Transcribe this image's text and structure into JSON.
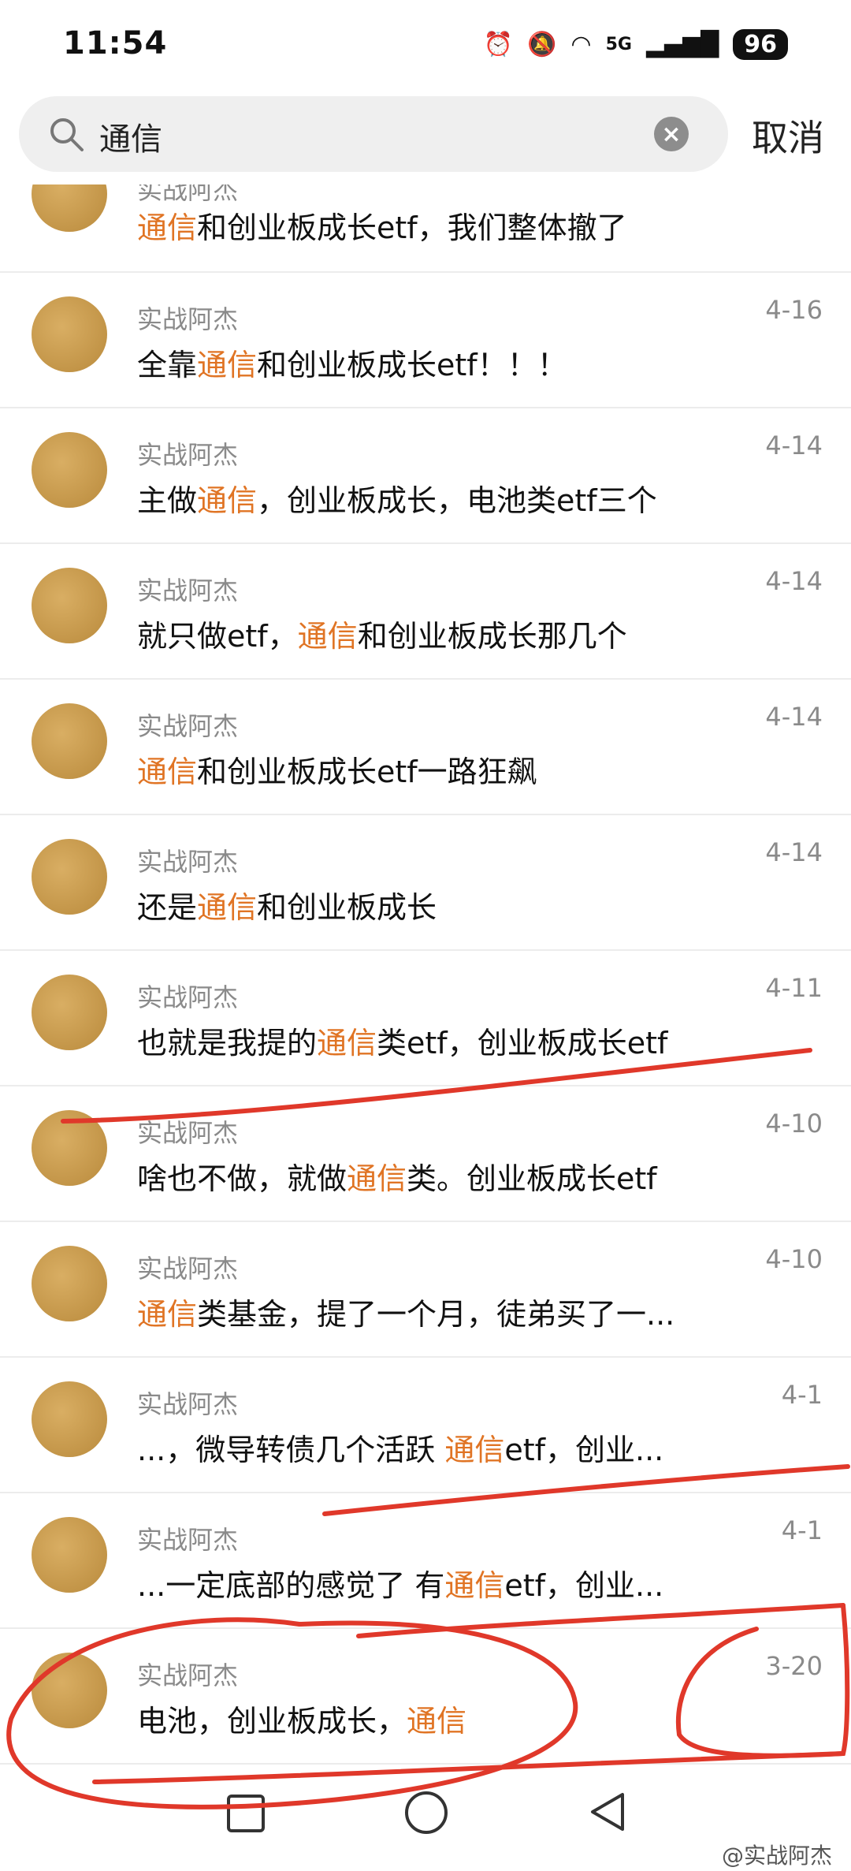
{
  "status": {
    "time": "11:54",
    "network": "5G",
    "battery": "96"
  },
  "search": {
    "query": "通信",
    "cancel_label": "取消"
  },
  "items": [
    {
      "author": "实战阿杰",
      "date": "",
      "parts": [
        {
          "t": "通信",
          "h": true
        },
        {
          "t": "和创业板成长etf，我们整体撤了",
          "h": false
        }
      ]
    },
    {
      "author": "实战阿杰",
      "date": "4-16",
      "parts": [
        {
          "t": "全靠",
          "h": false
        },
        {
          "t": "通信",
          "h": true
        },
        {
          "t": "和创业板成长etf！！！",
          "h": false
        }
      ]
    },
    {
      "author": "实战阿杰",
      "date": "4-14",
      "parts": [
        {
          "t": "主做",
          "h": false
        },
        {
          "t": "通信",
          "h": true
        },
        {
          "t": "，创业板成长，电池类etf三个",
          "h": false
        }
      ]
    },
    {
      "author": "实战阿杰",
      "date": "4-14",
      "parts": [
        {
          "t": "就只做etf，",
          "h": false
        },
        {
          "t": "通信",
          "h": true
        },
        {
          "t": "和创业板成长那几个",
          "h": false
        }
      ]
    },
    {
      "author": "实战阿杰",
      "date": "4-14",
      "parts": [
        {
          "t": "通信",
          "h": true
        },
        {
          "t": "和创业板成长etf一路狂飙",
          "h": false
        }
      ]
    },
    {
      "author": "实战阿杰",
      "date": "4-14",
      "parts": [
        {
          "t": "还是",
          "h": false
        },
        {
          "t": "通信",
          "h": true
        },
        {
          "t": "和创业板成长",
          "h": false
        }
      ]
    },
    {
      "author": "实战阿杰",
      "date": "4-11",
      "parts": [
        {
          "t": "也就是我提的",
          "h": false
        },
        {
          "t": "通信",
          "h": true
        },
        {
          "t": "类etf，创业板成长etf",
          "h": false
        }
      ]
    },
    {
      "author": "实战阿杰",
      "date": "4-10",
      "parts": [
        {
          "t": "啥也不做，就做",
          "h": false
        },
        {
          "t": "通信",
          "h": true
        },
        {
          "t": "类。创业板成长etf",
          "h": false
        }
      ]
    },
    {
      "author": "实战阿杰",
      "date": "4-10",
      "parts": [
        {
          "t": "通信",
          "h": true
        },
        {
          "t": "类基金，提了一个月，徒弟买了一...",
          "h": false
        }
      ]
    },
    {
      "author": "实战阿杰",
      "date": "4-1",
      "parts": [
        {
          "t": "...，微导转债几个活跃 ",
          "h": false
        },
        {
          "t": "通信",
          "h": true
        },
        {
          "t": "etf，创业...",
          "h": false
        }
      ]
    },
    {
      "author": "实战阿杰",
      "date": "4-1",
      "parts": [
        {
          "t": "...一定底部的感觉了 有",
          "h": false
        },
        {
          "t": "通信",
          "h": true
        },
        {
          "t": "etf，创业...",
          "h": false
        }
      ]
    },
    {
      "author": "实战阿杰",
      "date": "3-20",
      "parts": [
        {
          "t": "电池，创业板成长，",
          "h": false
        },
        {
          "t": "通信",
          "h": true
        }
      ]
    }
  ],
  "watermark": "@实战阿杰",
  "colors": {
    "highlight": "#e07424",
    "annotation": "#e0382a",
    "avatar": "#c89a4c"
  }
}
